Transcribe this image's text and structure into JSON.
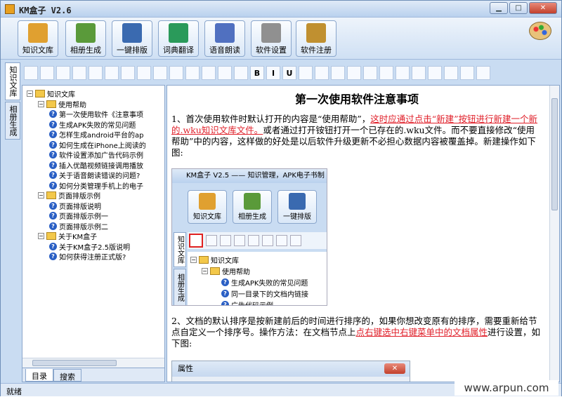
{
  "window": {
    "title": "KM盒子 V2.6",
    "min": "▁",
    "max": "□",
    "close": "✕"
  },
  "toolbar": [
    {
      "label": "知识文库",
      "icon": "books-icon",
      "color": "#e0a030"
    },
    {
      "label": "相册生成",
      "icon": "photo-album-icon",
      "color": "#5a9a3a"
    },
    {
      "label": "一键排版",
      "icon": "layout-icon",
      "color": "#3a6ab0"
    },
    {
      "label": "词典翻译",
      "icon": "translate-icon",
      "color": "#2a9a5a"
    },
    {
      "label": "语音朗读",
      "icon": "speech-icon",
      "color": "#5070c0"
    },
    {
      "label": "软件设置",
      "icon": "gear-icon",
      "color": "#909090"
    },
    {
      "label": "软件注册",
      "icon": "key-icon",
      "color": "#c09030"
    }
  ],
  "side_tabs": [
    "知识文库",
    "相册生成"
  ],
  "editor_buttons": [
    "new-icon",
    "open-icon",
    "save-icon",
    "print-icon",
    "preview-icon",
    "find-icon",
    "outdent-icon",
    "indent-icon",
    "hr-icon",
    "line-icon",
    "align-left-icon",
    "align-center-icon",
    "align-right-icon",
    "justify-icon",
    "bold-icon",
    "italic-icon",
    "underline-icon",
    "folder-icon",
    "binoculars-icon",
    "edit-icon",
    "cut-icon",
    "copy-icon",
    "paste-icon",
    "image-icon",
    "table-icon",
    "globe-icon",
    "clean-icon",
    "sound-icon",
    "word-icon"
  ],
  "editor_labels": {
    "bold-icon": "B",
    "italic-icon": "I",
    "underline-icon": "U"
  },
  "tree": [
    {
      "level": 0,
      "type": "folder",
      "exp": "−",
      "label": "知识文库"
    },
    {
      "level": 1,
      "type": "folder",
      "exp": "−",
      "label": "使用帮助"
    },
    {
      "level": 2,
      "type": "doc",
      "label": "第一次使用软件《注意事项"
    },
    {
      "level": 2,
      "type": "doc",
      "label": "生成APK失败的常见问题"
    },
    {
      "level": 2,
      "type": "doc",
      "label": "怎样生成android平台的ap"
    },
    {
      "level": 2,
      "type": "doc",
      "label": "如何生成在iPhone上阅读的"
    },
    {
      "level": 2,
      "type": "doc",
      "label": "软件设置添加广告代码示例"
    },
    {
      "level": 2,
      "type": "doc",
      "label": "插入优酷视频链接调用播放"
    },
    {
      "level": 2,
      "type": "doc",
      "label": "关于语音朗读错误的问题?"
    },
    {
      "level": 2,
      "type": "doc",
      "label": "如何分类管理手机上的电子"
    },
    {
      "level": 1,
      "type": "folder",
      "exp": "−",
      "label": "页面排版示例"
    },
    {
      "level": 2,
      "type": "doc",
      "label": "页面排版说明"
    },
    {
      "level": 2,
      "type": "doc",
      "label": "页面排版示例一"
    },
    {
      "level": 2,
      "type": "doc",
      "label": "页面排版示例二"
    },
    {
      "level": 1,
      "type": "folder",
      "exp": "−",
      "label": "关于KM盒子"
    },
    {
      "level": 2,
      "type": "doc",
      "label": "关于KM盒子2.5版说明"
    },
    {
      "level": 2,
      "type": "doc",
      "label": "如何获得注册正式版?"
    }
  ],
  "bottom_tabs": [
    "目录",
    "搜索"
  ],
  "doc": {
    "title": "第一次使用软件注意事项",
    "p1_a": "1、首次使用软件时默认打开的内容是“使用帮助”，",
    "p1_red": "这时应通过点击“新建”按钮进行新建一个新的.wku知识文库文件。",
    "p1_b": "或者通过打开铵钮打开一个已存在的.wku文件。而不要直接修改“使用帮助”中的内容，这样做的好处是以后软件升级更新不必担心数据内容被覆盖掉。新建操作如下图:",
    "p2_a": "2、文档的默认排序是按新建前后的时间进行排序的，如果你想改变原有的排序，需要重新给节点自定义一个排序号。操作方法：在文档节点上",
    "p2_red": "点右键选中右键菜单中的文档属性",
    "p2_b": "进行设置，如下图:"
  },
  "screenshot": {
    "title": "KM盒子 V2.5 —— 知识管理，APK电子书制",
    "buttons": [
      "知识文库",
      "相册生成",
      "一键排版"
    ],
    "side_tabs": [
      "知识文库",
      "相册生成"
    ],
    "tree": [
      "知识文库",
      "使用帮助",
      "生成APK失败的常见问题",
      "同一目录下的文档内链接",
      "广告代码示例"
    ]
  },
  "dialog": {
    "title": "属性",
    "close": "✕"
  },
  "status": {
    "text": "就绪"
  },
  "watermark": "www.arpun.com"
}
